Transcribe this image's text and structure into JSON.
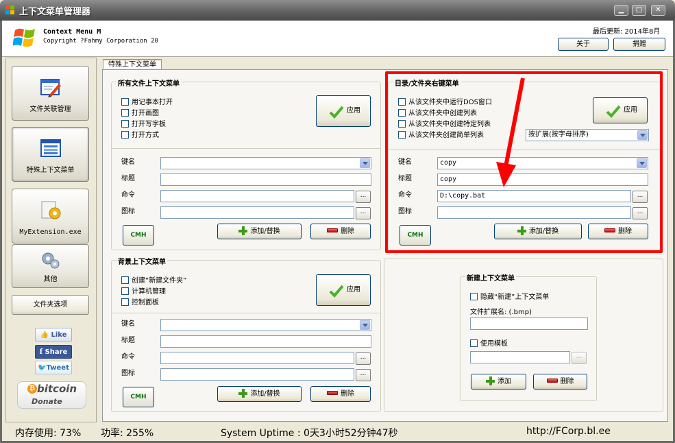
{
  "window": {
    "title": "上下文菜单管理器",
    "minimize": "▁",
    "maximize": "□",
    "close": "✕"
  },
  "header": {
    "brand_line1": "Context Menu M",
    "brand_line2": "Copyright ?Fahmy Corporation 20",
    "updated": "最后更新: 2014年8月",
    "about_button": "关于",
    "donate_button": "捐赠"
  },
  "sidebar": {
    "items": [
      {
        "label": "文件关联管理",
        "icon": "pencil-window-icon"
      },
      {
        "label": "特殊上下文菜单",
        "icon": "menu-list-icon"
      },
      {
        "label": "MyExtension.exe",
        "icon": "gear-document-icon"
      },
      {
        "label": "其他",
        "icon": "gears-icon"
      }
    ],
    "folder_options": "文件夹选项",
    "like": "Like",
    "share": "Share",
    "tweet": "Tweet",
    "bitcoin": "bitcoin",
    "donate": "Donate"
  },
  "tab": {
    "label": "特殊上下文菜单"
  },
  "all_files": {
    "title": "所有文件上下文菜单",
    "options": [
      "用记事本打开",
      "打开画图",
      "打开写字板",
      "打开方式"
    ],
    "apply": "应用",
    "labels": {
      "key": "键名",
      "title": "标题",
      "command": "命令",
      "icon": "图标"
    },
    "key_value": "",
    "title_value": "",
    "command_value": "",
    "icon_value": "",
    "cmh": "CMH",
    "add": "添加/替换",
    "delete": "删除",
    "browse": "..."
  },
  "folder": {
    "title": "目录/文件夹右键菜单",
    "options": [
      "从该文件夹中运行DOS窗口",
      "从该文件夹中创建列表",
      "从该文件夹中创建特定列表",
      "从该文件夹创建简单列表"
    ],
    "apply": "应用",
    "sort_select": "按扩展(按字母排序)",
    "labels": {
      "key": "键名",
      "title": "标题",
      "command": "命令",
      "icon": "图标"
    },
    "key_value": "copy",
    "title_value": "copy",
    "command_value": "D:\\copy.bat",
    "icon_value": "",
    "cmh": "CMH",
    "add": "添加/替换",
    "delete": "删除",
    "browse": "..."
  },
  "background": {
    "title": "背景上下文菜单",
    "options": [
      "创建“新建文件夹”",
      "计算机管理",
      "控制面板"
    ],
    "apply": "应用",
    "labels": {
      "key": "键名",
      "title": "标题",
      "command": "命令",
      "icon": "图标"
    },
    "key_value": "",
    "title_value": "",
    "command_value": "",
    "icon_value": "",
    "cmh": "CMH",
    "add": "添加/替换",
    "delete": "删除",
    "browse": "..."
  },
  "new_menu": {
    "title": "新建上下文菜单",
    "hide_option": "隐藏“新建”上下文菜单",
    "ext_label": "文件扩展名: (.bmp)",
    "ext_value": "",
    "template_option": "使用模板",
    "template_value": "",
    "add": "添加",
    "delete": "删除",
    "browse": "..."
  },
  "status": {
    "memory": "内存使用: 73%",
    "power": "功率: 255%",
    "uptime": "System Uptime : 0天3小时52分钟47秒",
    "url": "http://FCorp.bl.ee"
  },
  "colors": {
    "highlight": "#ff0000",
    "accent_tab": "#e68b2c"
  }
}
